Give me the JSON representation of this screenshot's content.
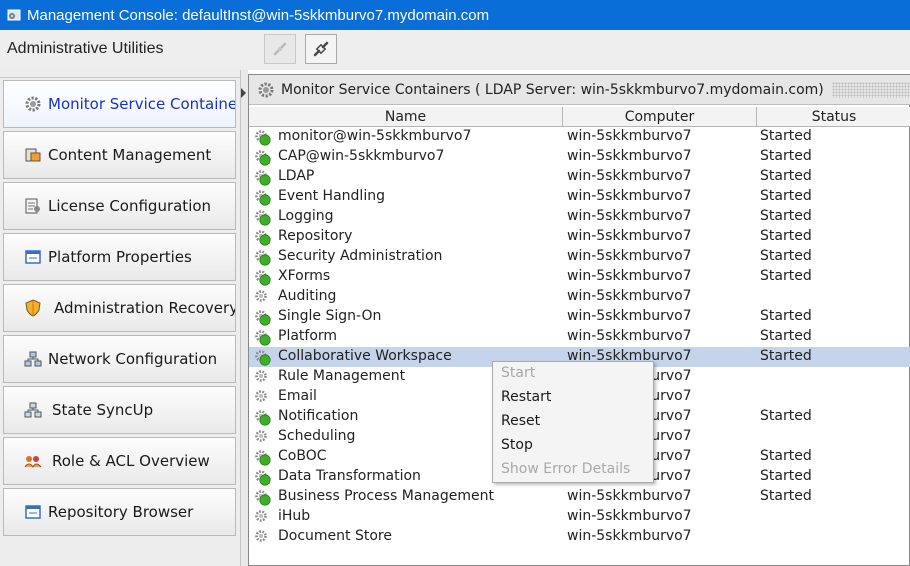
{
  "window": {
    "title": "Management Console: defaultInst@win-5skkmburvo7.mydomain.com"
  },
  "toolbar": {
    "label": "Administrative Utilities",
    "buttons": [
      {
        "icon": "disconnect-icon",
        "enabled": false
      },
      {
        "icon": "connect-icon",
        "enabled": true
      }
    ]
  },
  "sidebar": {
    "items": [
      {
        "label": "Monitor Service Containers",
        "icon": "gear-monitor-icon",
        "active": true
      },
      {
        "label": "Content Management",
        "icon": "content-icon"
      },
      {
        "label": "License Configuration",
        "icon": "license-icon"
      },
      {
        "label": "Platform Properties",
        "icon": "properties-icon"
      },
      {
        "label": "Administration Recovery",
        "icon": "shield-icon"
      },
      {
        "label": "Network Configuration",
        "icon": "network-icon"
      },
      {
        "label": "State SyncUp",
        "icon": "sync-icon"
      },
      {
        "label": "Role & ACL Overview",
        "icon": "roles-icon"
      },
      {
        "label": "Repository Browser",
        "icon": "repository-icon"
      }
    ]
  },
  "panel": {
    "title": "Monitor Service Containers ( LDAP Server: win-5skkmburvo7.mydomain.com)",
    "columns": {
      "name": "Name",
      "computer": "Computer",
      "status": "Status"
    }
  },
  "containers": [
    {
      "name": "monitor@win-5skkmburvo7",
      "computer": "win-5skkmburvo7",
      "status": "Started",
      "running": true
    },
    {
      "name": "CAP@win-5skkmburvo7",
      "computer": "win-5skkmburvo7",
      "status": "Started",
      "running": true
    },
    {
      "name": "LDAP",
      "computer": "win-5skkmburvo7",
      "status": "Started",
      "running": true
    },
    {
      "name": "Event Handling",
      "computer": "win-5skkmburvo7",
      "status": "Started",
      "running": true
    },
    {
      "name": "Logging",
      "computer": "win-5skkmburvo7",
      "status": "Started",
      "running": true
    },
    {
      "name": "Repository",
      "computer": "win-5skkmburvo7",
      "status": "Started",
      "running": true
    },
    {
      "name": "Security Administration",
      "computer": "win-5skkmburvo7",
      "status": "Started",
      "running": true
    },
    {
      "name": "XForms",
      "computer": "win-5skkmburvo7",
      "status": "Started",
      "running": true
    },
    {
      "name": "Auditing",
      "computer": "win-5skkmburvo7",
      "status": "",
      "running": false
    },
    {
      "name": "Single Sign-On",
      "computer": "win-5skkmburvo7",
      "status": "Started",
      "running": true
    },
    {
      "name": "Platform",
      "computer": "win-5skkmburvo7",
      "status": "Started",
      "running": true
    },
    {
      "name": "Collaborative Workspace",
      "computer": "win-5skkmburvo7",
      "status": "Started",
      "running": true,
      "selected": true
    },
    {
      "name": "Rule Management",
      "computer": "win-5skkmburvo7",
      "status": "",
      "running": false
    },
    {
      "name": "Email",
      "computer": "win-5skkmburvo7",
      "status": "",
      "running": false
    },
    {
      "name": "Notification",
      "computer": "win-5skkmburvo7",
      "status": "Started",
      "running": true
    },
    {
      "name": "Scheduling",
      "computer": "win-5skkmburvo7",
      "status": "",
      "running": false
    },
    {
      "name": "CoBOC",
      "computer": "win-5skkmburvo7",
      "status": "Started",
      "running": true
    },
    {
      "name": "Data Transformation",
      "computer": "win-5skkmburvo7",
      "status": "Started",
      "running": true
    },
    {
      "name": "Business Process Management",
      "computer": "win-5skkmburvo7",
      "status": "Started",
      "running": true
    },
    {
      "name": "iHub",
      "computer": "win-5skkmburvo7",
      "status": "",
      "running": false
    },
    {
      "name": "Document Store",
      "computer": "win-5skkmburvo7",
      "status": "",
      "running": false
    }
  ],
  "context_menu": {
    "items": [
      {
        "label": "Start",
        "enabled": false
      },
      {
        "label": "Restart",
        "enabled": true
      },
      {
        "label": "Reset",
        "enabled": true
      },
      {
        "label": "Stop",
        "enabled": true
      },
      {
        "label": "Show Error Details",
        "enabled": false
      }
    ]
  }
}
